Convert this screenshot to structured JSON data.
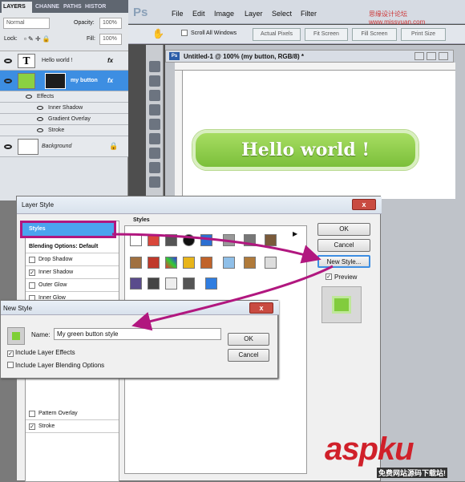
{
  "layers_panel": {
    "tabs": [
      "LAYERS",
      "CHANNE",
      "PATHS",
      "HISTOR"
    ],
    "blend_mode": "Normal",
    "opacity_label": "Opacity:",
    "opacity_value": "100%",
    "lock_label": "Lock:",
    "fill_label": "Fill:",
    "fill_value": "100%",
    "layers": [
      {
        "name": "Hello world !",
        "thumb": "T",
        "fx": "fx"
      },
      {
        "name": "my button",
        "fx": "fx"
      },
      {
        "name": "Background"
      }
    ],
    "effects_label": "Effects",
    "effects": [
      "Inner Shadow",
      "Gradient Overlay",
      "Stroke"
    ]
  },
  "photoshop": {
    "logo": "Ps",
    "menu": [
      "File",
      "Edit",
      "Image",
      "Layer",
      "Select",
      "Filter"
    ],
    "options": {
      "scroll_all": "Scroll All Windows",
      "actual_pixels": "Actual Pixels",
      "fit_screen": "Fit Screen",
      "fill_screen": "Fill Screen",
      "print_size": "Print Size"
    },
    "doc_title": "Untitled-1 @ 100% (my button, RGB/8) *",
    "button_text": "Hello world !"
  },
  "layer_style": {
    "title": "Layer Style",
    "close": "x",
    "left_items": [
      {
        "label": "Styles"
      },
      {
        "label": "Blending Options: Default"
      },
      {
        "label": "Drop Shadow",
        "checked": false
      },
      {
        "label": "Inner Shadow",
        "checked": true
      },
      {
        "label": "Outer Glow",
        "checked": false
      },
      {
        "label": "Inner Glow",
        "checked": false
      },
      {
        "label": "Pattern Overlay",
        "checked": false
      },
      {
        "label": "Stroke",
        "checked": true
      }
    ],
    "styles_label": "Styles",
    "ok": "OK",
    "cancel": "Cancel",
    "new_style": "New Style...",
    "preview": "Preview"
  },
  "new_style": {
    "title": "New Style",
    "close": "x",
    "name_label": "Name:",
    "name_value": "My green button style",
    "ok": "OK",
    "cancel": "Cancel",
    "include_effects": "Include Layer Effects",
    "include_blending": "Include Layer Blending Options"
  },
  "watermark": {
    "main": "aspku",
    "sub": "免费网站源码下载站!",
    "top": "思缘设计论坛 www.missyuan.com"
  },
  "colors": {
    "accent_magenta": "#b1177f",
    "button_green": "#7bbf3a",
    "selection_blue": "#4ba3ef"
  }
}
